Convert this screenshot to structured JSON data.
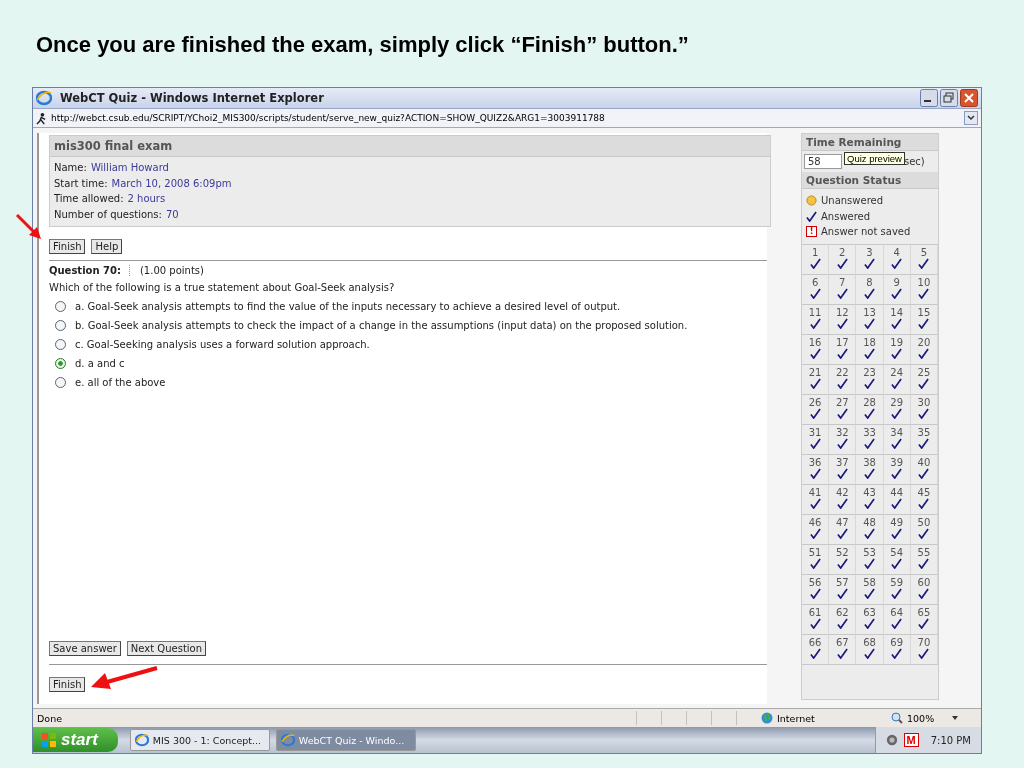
{
  "slide_heading": "Once you are finished the exam, simply click “Finish” button.”",
  "window": {
    "title": "WebCT Quiz - Windows Internet Explorer",
    "address": "http://webct.csub.edu/SCRIPT/YChoi2_MIS300/scripts/student/serve_new_quiz?ACTION=SHOW_QUIZ2&ARG1=3003911788"
  },
  "exam": {
    "title": "mis300 final exam",
    "info": [
      {
        "label": "Name:",
        "value": "William Howard"
      },
      {
        "label": "Start time:",
        "value": "March 10, 2008 6:09pm"
      },
      {
        "label": "Time allowed:",
        "value": "2 hours"
      },
      {
        "label": "Number of questions:",
        "value": "70"
      }
    ],
    "top_buttons": [
      "Finish",
      "Help"
    ]
  },
  "question": {
    "label": "Question 70:",
    "points": "(1.00 points)",
    "text": "Which of the following is a true statement about Goal-Seek analysis?",
    "options": [
      {
        "text": "a. Goal-Seek analysis attempts to find the value of the inputs necessary to achieve a desired level of output.",
        "selected": false
      },
      {
        "text": "b. Goal-Seek analysis attempts to check the impact of a change in the assumptions (input data) on the proposed solution.",
        "selected": false
      },
      {
        "text": "c. Goal-Seeking analysis uses a forward solution approach.",
        "selected": false
      },
      {
        "text": "d. a and c",
        "selected": true
      },
      {
        "text": "e. all of the above",
        "selected": false
      }
    ]
  },
  "bottom_buttons": [
    "Save answer",
    "Next Question"
  ],
  "finish_button": "Finish",
  "sidebar": {
    "time_heading": "Time Remaining",
    "time_value": "58",
    "time_unit": "sec)",
    "tooltip": "Quiz preview",
    "status_heading": "Question Status",
    "legend": [
      {
        "kind": "unanswered",
        "label": "Unanswered"
      },
      {
        "kind": "answered",
        "label": "Answered"
      },
      {
        "kind": "not_saved",
        "label": "Answer not saved",
        "mark": "!"
      }
    ],
    "questions": [
      {
        "number": "1",
        "answered": true
      },
      {
        "number": "2",
        "answered": true
      },
      {
        "number": "3",
        "answered": true
      },
      {
        "number": "4",
        "answered": true
      },
      {
        "number": "5",
        "answered": true
      },
      {
        "number": "6",
        "answered": true
      },
      {
        "number": "7",
        "answered": true
      },
      {
        "number": "8",
        "answered": true
      },
      {
        "number": "9",
        "answered": true
      },
      {
        "number": "10",
        "answered": true
      },
      {
        "number": "11",
        "answered": true
      },
      {
        "number": "12",
        "answered": true
      },
      {
        "number": "13",
        "answered": true
      },
      {
        "number": "14",
        "answered": true
      },
      {
        "number": "15",
        "answered": true
      },
      {
        "number": "16",
        "answered": true
      },
      {
        "number": "17",
        "answered": true
      },
      {
        "number": "18",
        "answered": true
      },
      {
        "number": "19",
        "answered": true
      },
      {
        "number": "20",
        "answered": true
      },
      {
        "number": "21",
        "answered": true
      },
      {
        "number": "22",
        "answered": true
      },
      {
        "number": "23",
        "answered": true
      },
      {
        "number": "24",
        "answered": true
      },
      {
        "number": "25",
        "answered": true
      },
      {
        "number": "26",
        "answered": true
      },
      {
        "number": "27",
        "answered": true
      },
      {
        "number": "28",
        "answered": true
      },
      {
        "number": "29",
        "answered": true
      },
      {
        "number": "30",
        "answered": true
      },
      {
        "number": "31",
        "answered": true
      },
      {
        "number": "32",
        "answered": true
      },
      {
        "number": "33",
        "answered": true
      },
      {
        "number": "34",
        "answered": true
      },
      {
        "number": "35",
        "answered": true
      },
      {
        "number": "36",
        "answered": true
      },
      {
        "number": "37",
        "answered": true
      },
      {
        "number": "38",
        "answered": true
      },
      {
        "number": "39",
        "answered": true
      },
      {
        "number": "40",
        "answered": true
      },
      {
        "number": "41",
        "answered": true
      },
      {
        "number": "42",
        "answered": true
      },
      {
        "number": "43",
        "answered": true
      },
      {
        "number": "44",
        "answered": true
      },
      {
        "number": "45",
        "answered": true
      },
      {
        "number": "46",
        "answered": true
      },
      {
        "number": "47",
        "answered": true
      },
      {
        "number": "48",
        "answered": true
      },
      {
        "number": "49",
        "answered": true
      },
      {
        "number": "50",
        "answered": true
      },
      {
        "number": "51",
        "answered": true
      },
      {
        "number": "52",
        "answered": true
      },
      {
        "number": "53",
        "answered": true
      },
      {
        "number": "54",
        "answered": true
      },
      {
        "number": "55",
        "answered": true
      },
      {
        "number": "56",
        "answered": true
      },
      {
        "number": "57",
        "answered": true
      },
      {
        "number": "58",
        "answered": true
      },
      {
        "number": "59",
        "answered": true
      },
      {
        "number": "60",
        "answered": true
      },
      {
        "number": "61",
        "answered": true
      },
      {
        "number": "62",
        "answered": true
      },
      {
        "number": "63",
        "answered": true
      },
      {
        "number": "64",
        "answered": true
      },
      {
        "number": "65",
        "answered": true
      },
      {
        "number": "66",
        "answered": true
      },
      {
        "number": "67",
        "answered": true
      },
      {
        "number": "68",
        "answered": true
      },
      {
        "number": "69",
        "answered": true
      },
      {
        "number": "70",
        "answered": true
      }
    ]
  },
  "status_bar": {
    "text": "Done",
    "zone": "Internet",
    "zoom": "100%"
  },
  "taskbar": {
    "start": "start",
    "tasks": [
      {
        "label": "MIS 300 - 1: Concept...",
        "selected": false
      },
      {
        "label": "WebCT Quiz - Windo...",
        "selected": true
      }
    ],
    "tray_mark": "M",
    "clock": "7:10 PM"
  }
}
